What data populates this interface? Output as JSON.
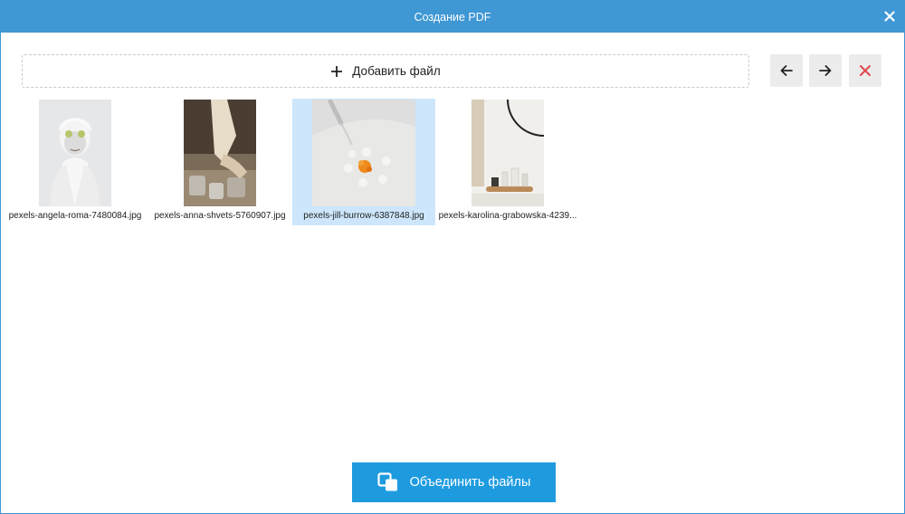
{
  "window": {
    "title": "Создание PDF"
  },
  "toolbar": {
    "add_file_label": "Добавить файл",
    "prev_icon": "arrow-left-icon",
    "next_icon": "arrow-right-icon",
    "delete_icon": "close-icon"
  },
  "files": [
    {
      "name": "pexels-angela-roma-7480084.jpg",
      "selected": false
    },
    {
      "name": "pexels-anna-shvets-5760907.jpg",
      "selected": false
    },
    {
      "name": "pexels-jill-burrow-6387848.jpg",
      "selected": true
    },
    {
      "name": "pexels-karolina-grabowska-4239...",
      "selected": false
    }
  ],
  "footer": {
    "merge_label": "Объединить файлы"
  },
  "colors": {
    "titlebar": "#3f97d4",
    "primary_button": "#1e9bdf",
    "selection": "#cde6fb",
    "delete_accent": "#e0474c"
  }
}
